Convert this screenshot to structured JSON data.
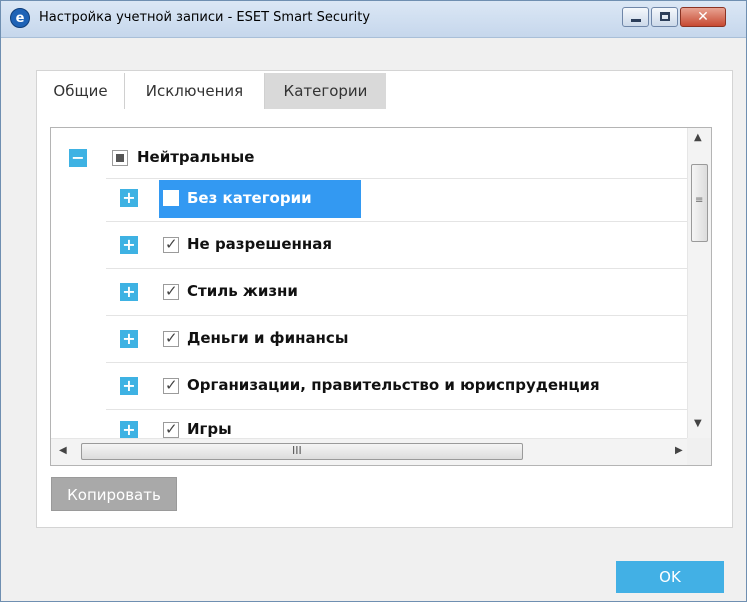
{
  "window": {
    "title": "Настройка учетной записи - ESET Smart Security",
    "app_icon_letter": "e",
    "close_glyph": "✕"
  },
  "tabs": [
    {
      "label": "Общие",
      "active": false
    },
    {
      "label": "Исключения",
      "active": false
    },
    {
      "label": "Категории",
      "active": true
    }
  ],
  "tree": {
    "root": {
      "label": "Нейтральные",
      "expander": "−",
      "state": "partial"
    },
    "children": [
      {
        "label": "Без категории",
        "expander": "+",
        "checked": false,
        "selected": true
      },
      {
        "label": "Не разрешенная",
        "expander": "+",
        "checked": true,
        "selected": false
      },
      {
        "label": "Стиль жизни",
        "expander": "+",
        "checked": true,
        "selected": false
      },
      {
        "label": "Деньги и финансы",
        "expander": "+",
        "checked": true,
        "selected": false
      },
      {
        "label": "Организации, правительство и юриспруденция",
        "expander": "+",
        "checked": true,
        "selected": false
      },
      {
        "label": "Игры",
        "expander": "+",
        "checked": true,
        "selected": false
      }
    ],
    "check_glyph": "✓"
  },
  "scrollbars": {
    "h_grip": "III",
    "v_grip": "≡"
  },
  "buttons": {
    "copy_label": "Копировать",
    "ok_label": "OK"
  },
  "colors": {
    "accent": "#3eb2e3",
    "selection": "#3399f2",
    "ok_button": "#42b0e5",
    "copy_button": "#a9a9a9"
  }
}
